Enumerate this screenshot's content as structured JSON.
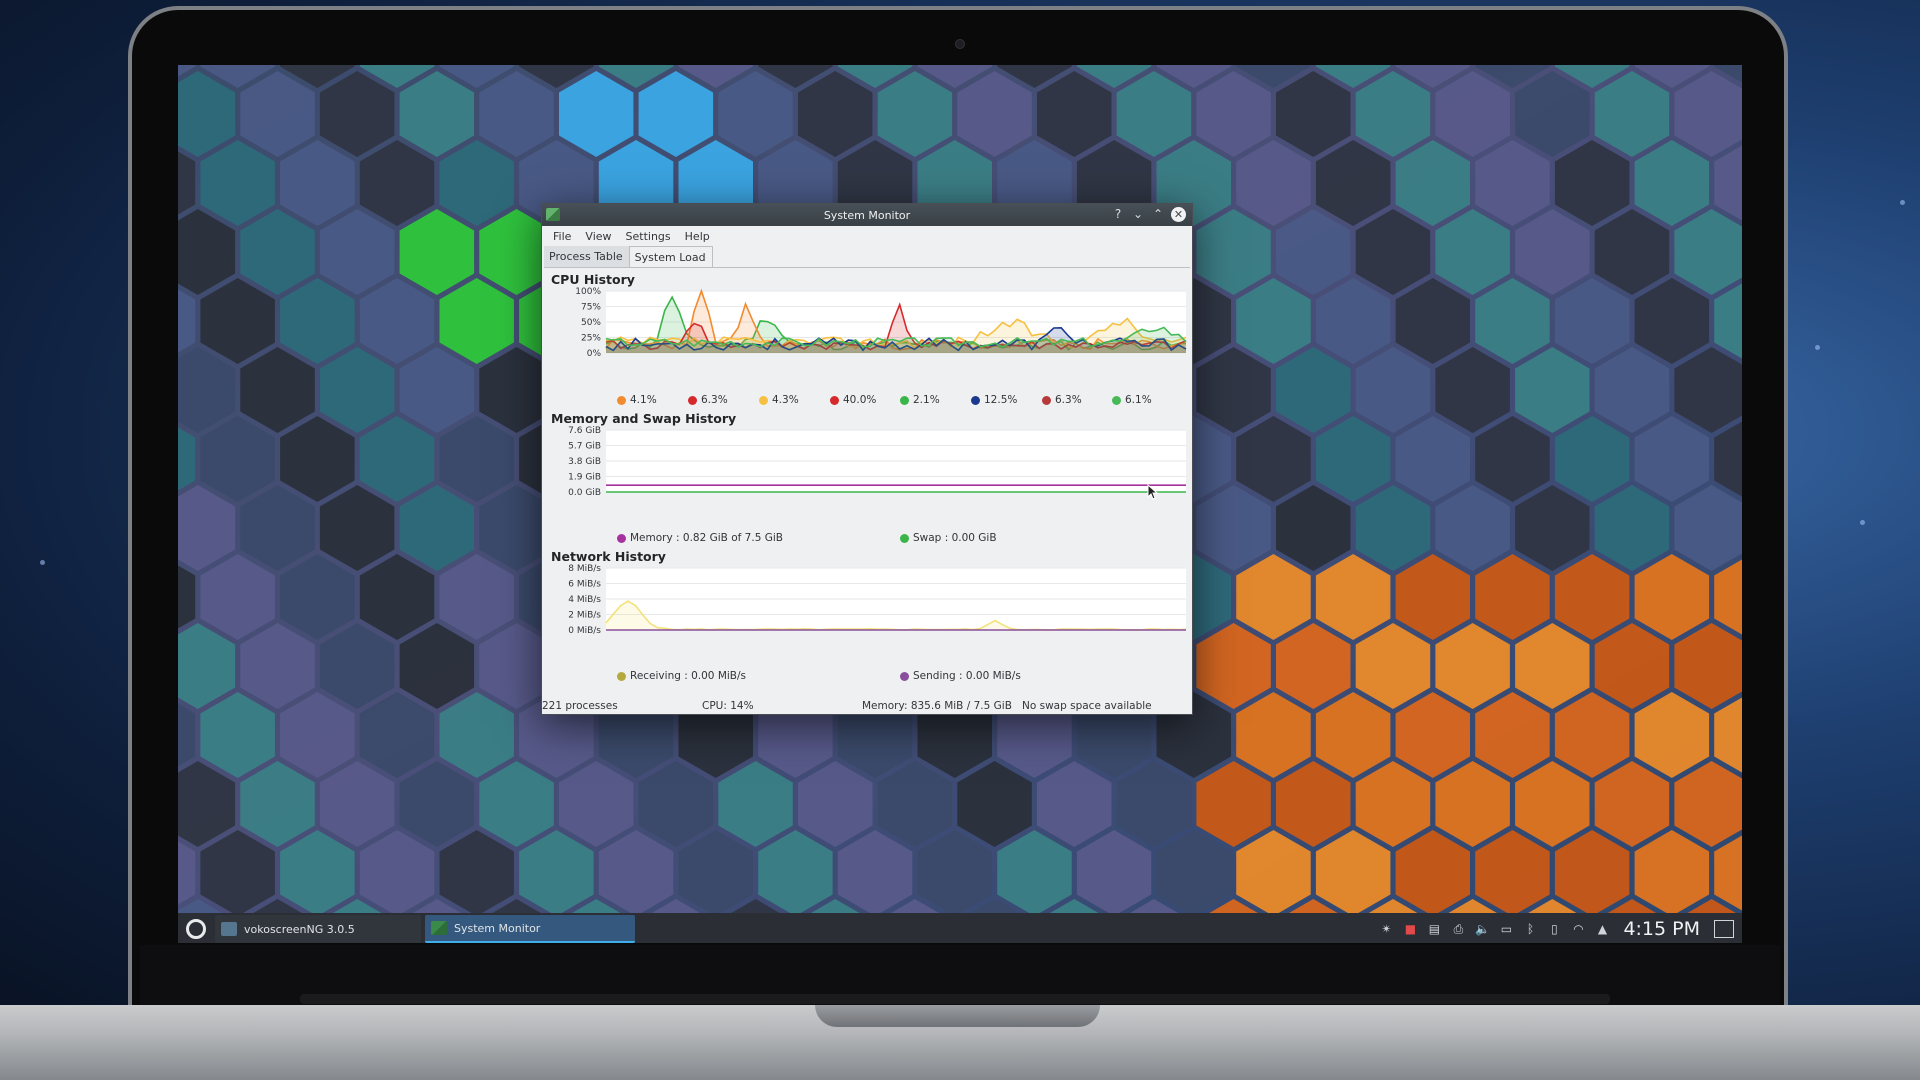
{
  "window": {
    "title": "System Monitor",
    "controls": {
      "help": "?",
      "minimize": "⌄",
      "maximize": "⌃",
      "close": "✕"
    }
  },
  "menu": [
    "File",
    "View",
    "Settings",
    "Help"
  ],
  "tabs": [
    "Process Table",
    "System Load"
  ],
  "cpu": {
    "title": "CPU History",
    "yticks": [
      "100%",
      "75%",
      "50%",
      "25%",
      "0%"
    ],
    "legend": [
      {
        "label": "4.1%",
        "color": "#f28b30"
      },
      {
        "label": "6.3%",
        "color": "#d5292c"
      },
      {
        "label": "4.3%",
        "color": "#f6c142"
      },
      {
        "label": "40.0%",
        "color": "#d5292c"
      },
      {
        "label": "2.1%",
        "color": "#3ab54a"
      },
      {
        "label": "12.5%",
        "color": "#1b3a8f"
      },
      {
        "label": "6.3%",
        "color": "#b73a3a"
      },
      {
        "label": "6.1%",
        "color": "#48b957"
      }
    ]
  },
  "memory": {
    "title": "Memory and Swap History",
    "yticks": [
      "7.6 GiB",
      "5.7 GiB",
      "3.8 GiB",
      "1.9 GiB",
      "0.0 GiB"
    ],
    "legend": [
      {
        "label": "Memory : 0.82 GiB of 7.5 GiB",
        "color": "#a6329e"
      },
      {
        "label": "Swap : 0.00 GiB",
        "color": "#3ab54a"
      }
    ]
  },
  "network": {
    "title": "Network History",
    "yticks": [
      "8 MiB/s",
      "6 MiB/s",
      "4 MiB/s",
      "2 MiB/s",
      "0 MiB/s"
    ],
    "legend": [
      {
        "label": "Receiving : 0.00 MiB/s",
        "color": "#b5a93e"
      },
      {
        "label": "Sending : 0.00 MiB/s",
        "color": "#8a4f9c"
      }
    ]
  },
  "status": {
    "processes": "221 processes",
    "cpu": "CPU: 14%",
    "memory": "Memory: 835.6 MiB / 7.5 GiB",
    "swap": "No swap space available"
  },
  "taskbar": {
    "tasks": [
      "vokoscreenNG 3.0.5",
      "System Monitor"
    ],
    "clock": "4:15 PM"
  },
  "colors": {
    "accent": "#3daee9",
    "window_bg": "#eff0f1",
    "taskbar_bg": "#2b2f35"
  }
}
